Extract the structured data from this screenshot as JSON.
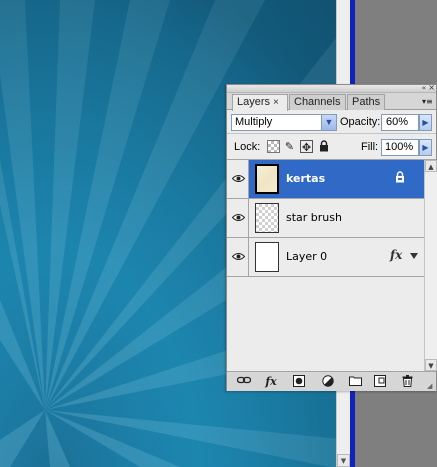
{
  "panel": {
    "tabs": [
      {
        "label": "Layers",
        "active": true,
        "close_glyph": "×"
      },
      {
        "label": "Channels",
        "active": false
      },
      {
        "label": "Paths",
        "active": false
      }
    ],
    "titlebar": {
      "collapse_glyph": "«",
      "close_glyph": "×"
    },
    "menu_icon": "panel-menu-icon"
  },
  "options": {
    "blend_mode": "Multiply",
    "opacity_label": "Opacity:",
    "opacity_value": "60%",
    "lock_label": "Lock:",
    "fill_label": "Fill:",
    "fill_value": "100%"
  },
  "layers": [
    {
      "name": "kertas",
      "selected": true,
      "visible": true,
      "thumbnail": "paper-texture",
      "locked": true
    },
    {
      "name": "star brush",
      "selected": false,
      "visible": true,
      "thumbnail": "transparent"
    },
    {
      "name": "Layer 0",
      "selected": false,
      "visible": true,
      "thumbnail": "white",
      "has_effects": true
    }
  ],
  "fx_label": "fx",
  "bottom_bar": {
    "buttons": [
      "link-layers",
      "layer-style",
      "add-layer-mask",
      "new-adjustment-layer",
      "new-group",
      "new-layer",
      "delete-layer"
    ],
    "fx_label": "fx"
  },
  "colors": {
    "canvas_blue": "#1c89b3",
    "selection_blue": "#3169c6",
    "panel_bg": "#ececec"
  }
}
